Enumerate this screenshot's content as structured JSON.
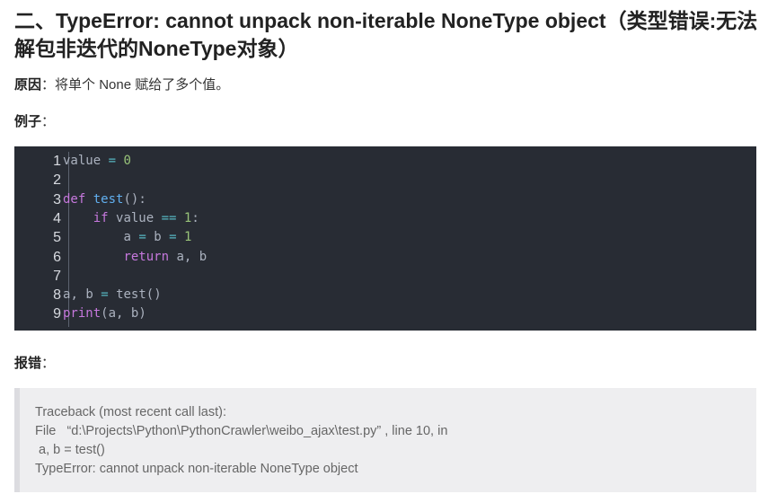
{
  "heading": "二、TypeError: cannot unpack non-iterable NoneType object（类型错误:无法解包非迭代的NoneType对象）",
  "reason": {
    "label": "原因",
    "colon": "：",
    "text": "将单个 None 赋给了多个值。"
  },
  "example": {
    "label": "例子",
    "colon": "："
  },
  "code": {
    "line_numbers": [
      "1",
      "2",
      "3",
      "4",
      "5",
      "6",
      "7",
      "8",
      "9"
    ],
    "lines": [
      "value = 0",
      "",
      "def test():",
      "    if value == 1:",
      "        a = b = 1",
      "        return a, b",
      "",
      "a, b = test()",
      "print(a, b)"
    ]
  },
  "error": {
    "label": "报错",
    "colon": "："
  },
  "traceback": [
    "Traceback (most recent call last):",
    "File   “d:\\Projects\\Python\\PythonCrawler\\weibo_ajax\\test.py” , line 10, in",
    " a, b = test()",
    "TypeError: cannot unpack non-iterable NoneType object"
  ],
  "colors": {
    "code_bg": "#282c34",
    "keyword": "#c678dd",
    "function": "#61afef",
    "number": "#98c379",
    "operator": "#56b6c2",
    "quote_bg": "#eeeef0"
  }
}
